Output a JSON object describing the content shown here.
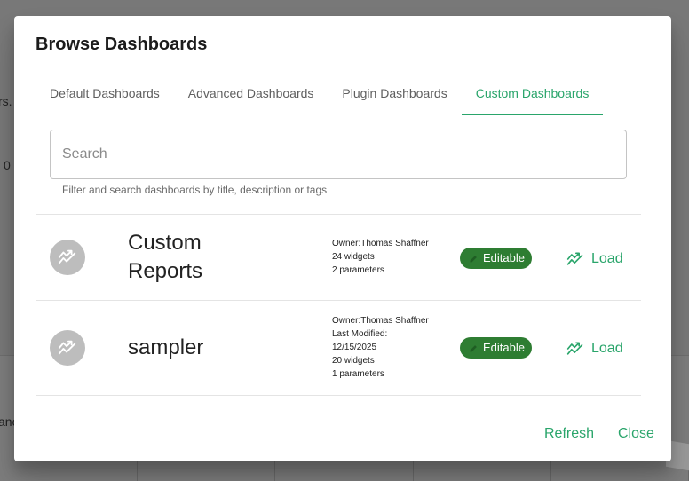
{
  "colors": {
    "accent": "#2aa56b",
    "chip": "#2e7d32",
    "avatar": "#bdbdbd"
  },
  "background": {
    "fragment_1": "rs.",
    "fragment_2": "0",
    "fragment_3": "anc"
  },
  "dialog": {
    "title": "Browse Dashboards",
    "tabs": [
      {
        "label": "Default Dashboards",
        "active": false
      },
      {
        "label": "Advanced Dashboards",
        "active": false
      },
      {
        "label": "Plugin Dashboards",
        "active": false
      },
      {
        "label": "Custom Dashboards",
        "active": true
      }
    ],
    "search": {
      "placeholder": "Search",
      "value": "",
      "helper": "Filter and search dashboards by title, description or tags"
    },
    "dashboards": [
      {
        "icon": "trending-up-icon",
        "title": "Custom Reports",
        "meta": [
          "Owner:Thomas Shaffner",
          "24 widgets",
          "2 parameters"
        ],
        "chip": "Editable",
        "action": "Load"
      },
      {
        "icon": "trending-up-icon",
        "title": "sampler",
        "meta": [
          "Owner:Thomas Shaffner",
          "Last Modified:",
          "12/15/2025",
          "20 widgets",
          "1 parameters"
        ],
        "chip": "Editable",
        "action": "Load"
      }
    ],
    "footer": {
      "refresh": "Refresh",
      "close": "Close"
    }
  }
}
